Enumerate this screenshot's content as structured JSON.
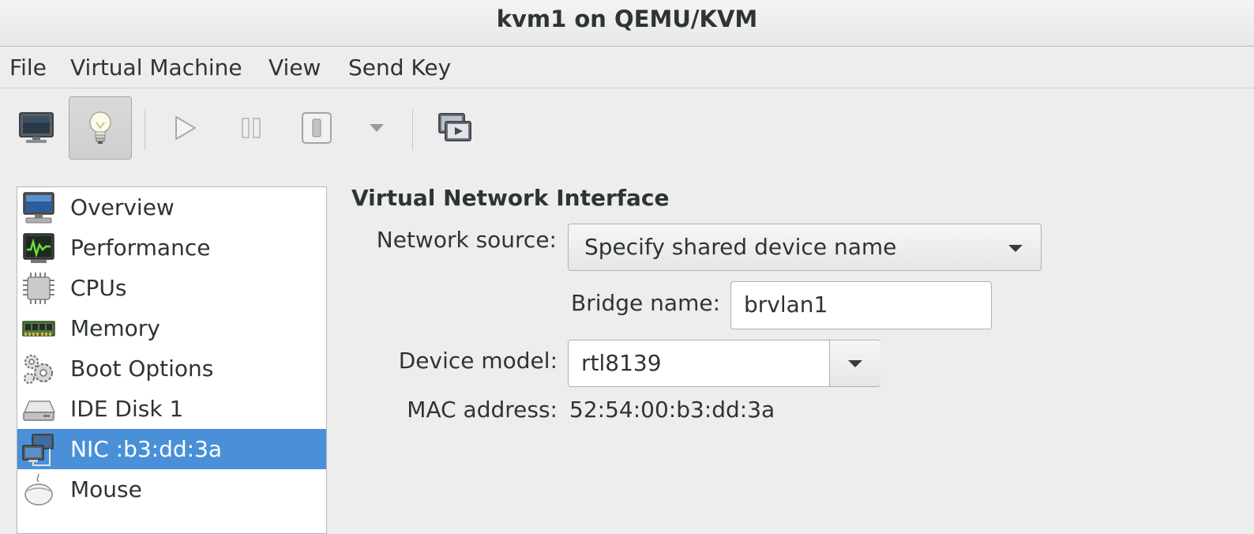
{
  "window": {
    "title": "kvm1 on QEMU/KVM"
  },
  "menubar": {
    "items": [
      {
        "label": "File"
      },
      {
        "label": "Virtual Machine"
      },
      {
        "label": "View"
      },
      {
        "label": "Send Key"
      }
    ]
  },
  "toolbar": {
    "buttons": [
      {
        "icon": "monitor-icon",
        "state": "normal"
      },
      {
        "icon": "lightbulb-icon",
        "state": "active"
      },
      {
        "icon": "play-icon",
        "state": "disabled"
      },
      {
        "icon": "pause-icon",
        "state": "disabled"
      },
      {
        "icon": "power-icon",
        "state": "disabled"
      },
      {
        "icon": "chevron-down-icon",
        "state": "disabled"
      },
      {
        "icon": "fullscreen-icon",
        "state": "normal"
      }
    ]
  },
  "sidebar": {
    "selected_color": "#4a90d9",
    "items": [
      {
        "label": "Overview",
        "icon": "overview-monitor-icon"
      },
      {
        "label": "Performance",
        "icon": "performance-chart-icon"
      },
      {
        "label": "CPUs",
        "icon": "cpu-chip-icon"
      },
      {
        "label": "Memory",
        "icon": "memory-module-icon"
      },
      {
        "label": "Boot Options",
        "icon": "gears-icon"
      },
      {
        "label": "IDE Disk 1",
        "icon": "hard-disk-icon"
      },
      {
        "label": "NIC :b3:dd:3a",
        "icon": "network-icon",
        "selected": true
      },
      {
        "label": "Mouse",
        "icon": "mouse-icon"
      }
    ]
  },
  "details": {
    "title": "Virtual Network Interface",
    "network_source": {
      "label": "Network source:",
      "value": "Specify shared device name"
    },
    "bridge_name": {
      "label": "Bridge name:",
      "value": "brvlan1"
    },
    "device_model": {
      "label": "Device model:",
      "value": "rtl8139"
    },
    "mac_address": {
      "label": "MAC address:",
      "value": "52:54:00:b3:dd:3a"
    }
  }
}
